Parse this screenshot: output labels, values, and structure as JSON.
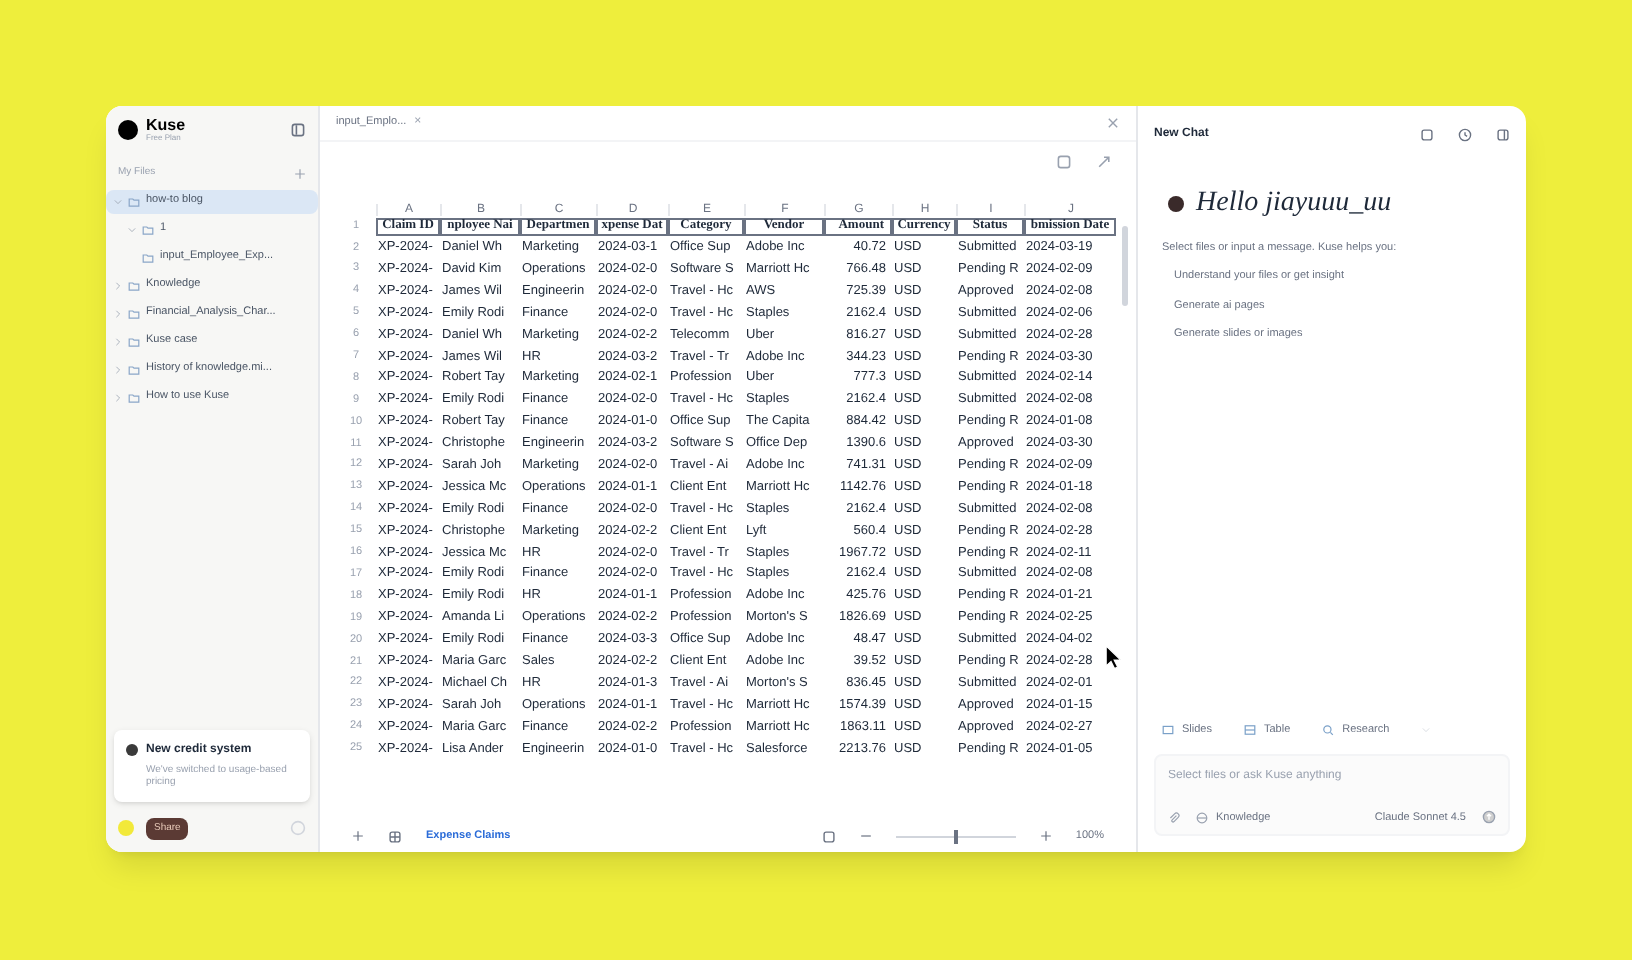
{
  "sidebar": {
    "brand": "Kuse",
    "subtitle": "Free Plan",
    "section": "My Files",
    "tree": [
      {
        "label": "how-to blog",
        "selected": true,
        "expanded": true,
        "children": [
          {
            "label": "1",
            "selected": false,
            "expanded": true,
            "children": [
              {
                "label": "input_Employee_Exp...",
                "selected": false
              }
            ]
          }
        ]
      },
      {
        "label": "Knowledge",
        "selected": false,
        "expanded": false
      },
      {
        "label": "Financial_Analysis_Char...",
        "selected": false,
        "expanded": false
      },
      {
        "label": "Kuse case",
        "selected": false,
        "expanded": false
      },
      {
        "label": "History of knowledge.mi...",
        "selected": false,
        "expanded": false
      },
      {
        "label": "How to use Kuse",
        "selected": false,
        "expanded": false
      }
    ],
    "notice": {
      "title": "New credit system",
      "text": "We've switched to usage-based pricing"
    },
    "share": "Share"
  },
  "editor": {
    "tab": "input_Emplo...",
    "tab_close": "×",
    "sheet_tab": "Expense Claims",
    "zoom_slider": {
      "level": 0.5
    },
    "zoom": "100%",
    "row_numbers": [
      "1",
      "2",
      "3",
      "4",
      "5",
      "6",
      "7",
      "8",
      "9",
      "10",
      "11",
      "12",
      "13",
      "14",
      "15",
      "16",
      "17",
      "18",
      "19",
      "20",
      "21",
      "22",
      "23",
      "24",
      "25"
    ],
    "columns": [
      "A",
      "B",
      "C",
      "D",
      "E",
      "F",
      "G",
      "H",
      "I",
      "J"
    ],
    "rows": [
      [
        "Claim ID",
        "nployee Nai",
        "Departmen",
        "xpense Dat",
        "Category",
        "Vendor",
        "Amount",
        "Currency",
        "Status",
        "bmission Date"
      ],
      [
        "XP-2024-",
        "Daniel Wh",
        "Marketing",
        "2024-03-1",
        "Office Sup",
        "Adobe Inc",
        "40.72",
        "USD",
        "Submitted",
        "2024-03-19"
      ],
      [
        "XP-2024-",
        "David Kim",
        "Operations",
        "2024-02-0",
        "Software S",
        "Marriott Hc",
        "766.48",
        "USD",
        "Pending R",
        "2024-02-09"
      ],
      [
        "XP-2024-",
        "James Wil",
        "Engineerin",
        "2024-02-0",
        "Travel - Hc",
        "AWS",
        "725.39",
        "USD",
        "Approved",
        "2024-02-08"
      ],
      [
        "XP-2024-",
        "Emily Rodi",
        "Finance",
        "2024-02-0",
        "Travel - Hc",
        "Staples",
        "2162.4",
        "USD",
        "Submitted",
        "2024-02-06"
      ],
      [
        "XP-2024-",
        "Daniel Wh",
        "Marketing",
        "2024-02-2",
        "Telecomm",
        "Uber",
        "816.27",
        "USD",
        "Submitted",
        "2024-02-28"
      ],
      [
        "XP-2024-",
        "James Wil",
        "HR",
        "2024-03-2",
        "Travel - Tr",
        "Adobe Inc",
        "344.23",
        "USD",
        "Pending R",
        "2024-03-30"
      ],
      [
        "XP-2024-",
        "Robert Tay",
        "Marketing",
        "2024-02-1",
        "Profession",
        "Uber",
        "777.3",
        "USD",
        "Submitted",
        "2024-02-14"
      ],
      [
        "XP-2024-",
        "Emily Rodi",
        "Finance",
        "2024-02-0",
        "Travel - Hc",
        "Staples",
        "2162.4",
        "USD",
        "Submitted",
        "2024-02-08"
      ],
      [
        "XP-2024-",
        "Robert Tay",
        "Finance",
        "2024-01-0",
        "Office Sup",
        "The Capita",
        "884.42",
        "USD",
        "Pending R",
        "2024-01-08"
      ],
      [
        "XP-2024-",
        "Christophe",
        "Engineerin",
        "2024-03-2",
        "Software S",
        "Office Dep",
        "1390.6",
        "USD",
        "Approved",
        "2024-03-30"
      ],
      [
        "XP-2024-",
        "Sarah Joh",
        "Marketing",
        "2024-02-0",
        "Travel - Ai",
        "Adobe Inc",
        "741.31",
        "USD",
        "Pending R",
        "2024-02-09"
      ],
      [
        "XP-2024-",
        "Jessica Mc",
        "Operations",
        "2024-01-1",
        "Client Ent",
        "Marriott Hc",
        "1142.76",
        "USD",
        "Pending R",
        "2024-01-18"
      ],
      [
        "XP-2024-",
        "Emily Rodi",
        "Finance",
        "2024-02-0",
        "Travel - Hc",
        "Staples",
        "2162.4",
        "USD",
        "Submitted",
        "2024-02-08"
      ],
      [
        "XP-2024-",
        "Christophe",
        "Marketing",
        "2024-02-2",
        "Client Ent",
        "Lyft",
        "560.4",
        "USD",
        "Pending R",
        "2024-02-28"
      ],
      [
        "XP-2024-",
        "Jessica Mc",
        "HR",
        "2024-02-0",
        "Travel - Tr",
        "Staples",
        "1967.72",
        "USD",
        "Pending R",
        "2024-02-11"
      ],
      [
        "XP-2024-",
        "Emily Rodi",
        "Finance",
        "2024-02-0",
        "Travel - Hc",
        "Staples",
        "2162.4",
        "USD",
        "Submitted",
        "2024-02-08"
      ],
      [
        "XP-2024-",
        "Emily Rodi",
        "HR",
        "2024-01-1",
        "Profession",
        "Adobe Inc",
        "425.76",
        "USD",
        "Pending R",
        "2024-01-21"
      ],
      [
        "XP-2024-",
        "Amanda Li",
        "Operations",
        "2024-02-2",
        "Profession",
        "Morton's S",
        "1826.69",
        "USD",
        "Pending R",
        "2024-02-25"
      ],
      [
        "XP-2024-",
        "Emily Rodi",
        "Finance",
        "2024-03-3",
        "Office Sup",
        "Adobe Inc",
        "48.47",
        "USD",
        "Submitted",
        "2024-04-02"
      ],
      [
        "XP-2024-",
        "Maria Garc",
        "Sales",
        "2024-02-2",
        "Client Ent",
        "Adobe Inc",
        "39.52",
        "USD",
        "Pending R",
        "2024-02-28"
      ],
      [
        "XP-2024-",
        "Michael Ch",
        "HR",
        "2024-01-3",
        "Travel - Ai",
        "Morton's S",
        "836.45",
        "USD",
        "Submitted",
        "2024-02-01"
      ],
      [
        "XP-2024-",
        "Sarah Joh",
        "Operations",
        "2024-01-1",
        "Travel - Hc",
        "Marriott Hc",
        "1574.39",
        "USD",
        "Approved",
        "2024-01-15"
      ],
      [
        "XP-2024-",
        "Maria Garc",
        "Finance",
        "2024-02-2",
        "Profession",
        "Marriott Hc",
        "1863.11",
        "USD",
        "Approved",
        "2024-02-27"
      ],
      [
        "XP-2024-",
        "Lisa Ander",
        "Engineerin",
        "2024-01-0",
        "Travel - Hc",
        "Salesforce",
        "2213.76",
        "USD",
        "Pending R",
        "2024-01-05"
      ]
    ]
  },
  "chat": {
    "title": "New Chat",
    "greeting": "Hello jiayuuu_uu",
    "intro": "Select files or input a message. Kuse helps you:",
    "suggestions": [
      "Understand your files or get insight",
      "Generate ai pages",
      "Generate slides or images"
    ],
    "chips": [
      "Slides",
      "Table",
      "Research"
    ],
    "placeholder": "Select files or ask Kuse anything",
    "sources": "Knowledge",
    "model": "Claude Sonnet 4.5"
  }
}
